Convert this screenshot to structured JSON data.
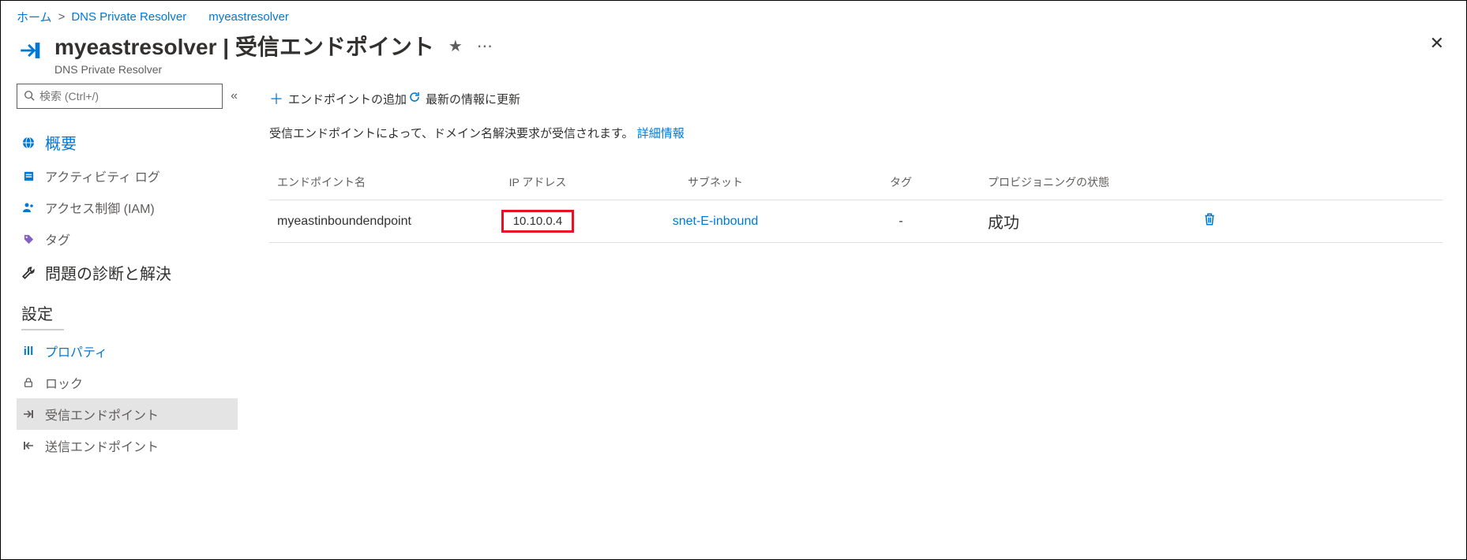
{
  "breadcrumb": {
    "home": "ホーム",
    "resourceType": "DNS Private Resolver",
    "current": "myeastresolver"
  },
  "header": {
    "title": "myeastresolver | 受信エンドポイント",
    "subtitle": "DNS Private Resolver"
  },
  "sidebar": {
    "searchPlaceholder": "検索 (Ctrl+/)",
    "items": [
      {
        "label": "概要"
      },
      {
        "label": "アクティビティ ログ"
      },
      {
        "label": "アクセス制御 (IAM)"
      },
      {
        "label": "タグ"
      },
      {
        "label": "問題の診断と解決"
      }
    ],
    "settingsLabel": "設定",
    "settingsItems": [
      {
        "label": "プロパティ"
      },
      {
        "label": "ロック"
      },
      {
        "label": "受信エンドポイント"
      },
      {
        "label": "送信エンドポイント"
      }
    ]
  },
  "toolbar": {
    "addEndpoint": "エンドポイントの追加",
    "refresh": "最新の情報に更新"
  },
  "main": {
    "description": "受信エンドポイントによって、ドメイン名解決要求が受信されます。",
    "moreInfo": "詳細情報",
    "columns": {
      "name": "エンドポイント名",
      "ip": "IP アドレス",
      "subnet": "サブネット",
      "tag": "タグ",
      "state": "プロビジョニングの状態"
    },
    "rows": [
      {
        "name": "myeastinboundendpoint",
        "ip": "10.10.0.4",
        "subnet": "snet-E-inbound",
        "tag": "-",
        "state": "成功"
      }
    ]
  }
}
